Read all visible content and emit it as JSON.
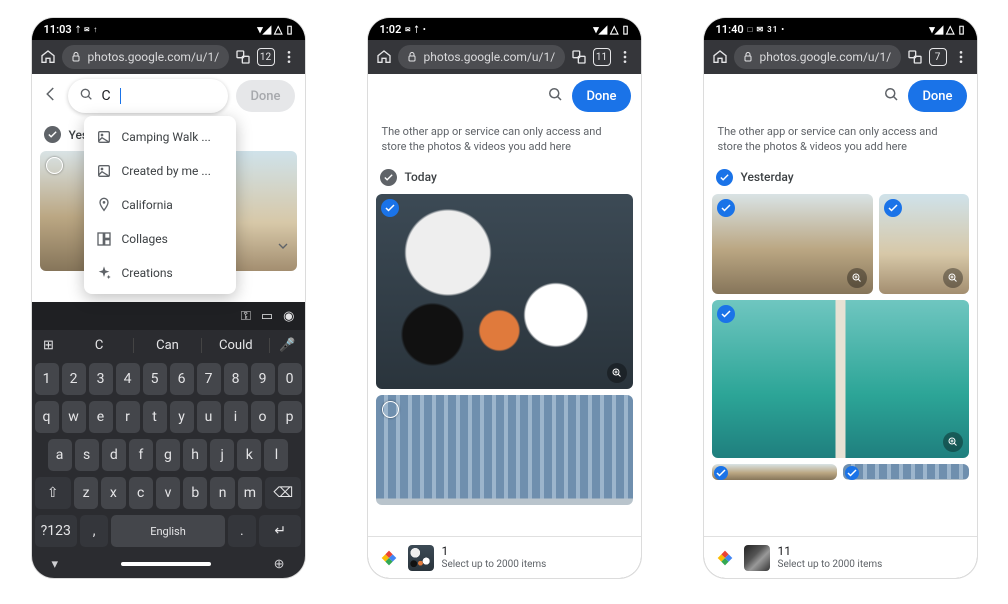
{
  "screens": {
    "a": {
      "time": "11:03",
      "status_left_glyphs": "ᛏ ✉ ↑",
      "status_right_glyphs": "▾◢ △",
      "url": "photos.google.com/u/1/",
      "tab_count": "12",
      "search_value": "C",
      "done_label": "Done",
      "group_label": "Yest",
      "suggestions": [
        {
          "icon": "album",
          "label": "Camping Walk ..."
        },
        {
          "icon": "album",
          "label": "Created by me ..."
        },
        {
          "icon": "pin",
          "label": "California"
        },
        {
          "icon": "collage",
          "label": "Collages"
        },
        {
          "icon": "sparkle",
          "label": "Creations"
        }
      ],
      "keyboard": {
        "suggestions": [
          "C",
          "Can",
          "Could"
        ],
        "row1": [
          "1",
          "2",
          "3",
          "4",
          "5",
          "6",
          "7",
          "8",
          "9",
          "0"
        ],
        "row2": [
          "q",
          "w",
          "e",
          "r",
          "t",
          "y",
          "u",
          "i",
          "o",
          "p"
        ],
        "row3": [
          "a",
          "s",
          "d",
          "f",
          "g",
          "h",
          "j",
          "k",
          "l"
        ],
        "row4": [
          "z",
          "x",
          "c",
          "v",
          "b",
          "n",
          "m"
        ],
        "shift": "⇧",
        "backspace": "⌫",
        "numkey": "?123",
        "comma": ",",
        "lang": "English",
        "period": ".",
        "enter": "↵",
        "emoji": "☺",
        "mic": "●",
        "globe": "⊕",
        "chev": "▾"
      }
    },
    "b": {
      "time": "1:02",
      "status_left_glyphs": "✉ ᛏ •",
      "status_right_glyphs": "▾◢ △",
      "url": "photos.google.com/u/1/",
      "tab_count": "11",
      "done_label": "Done",
      "info": "The other app or service can only access and store the photos & videos you add here",
      "group_label": "Today",
      "selection": {
        "count": "1",
        "limit": "Select up to 2000 items"
      }
    },
    "c": {
      "time": "11:40",
      "status_left_glyphs": "□ ✉ 31 •",
      "status_right_glyphs": "▾◢ △",
      "url": "photos.google.com/u/1/",
      "tab_count": "7",
      "done_label": "Done",
      "info": "The other app or service can only access and store the photos & videos you add here",
      "group_label": "Yesterday",
      "selection": {
        "count": "11",
        "limit": "Select up to 2000 items"
      }
    }
  }
}
